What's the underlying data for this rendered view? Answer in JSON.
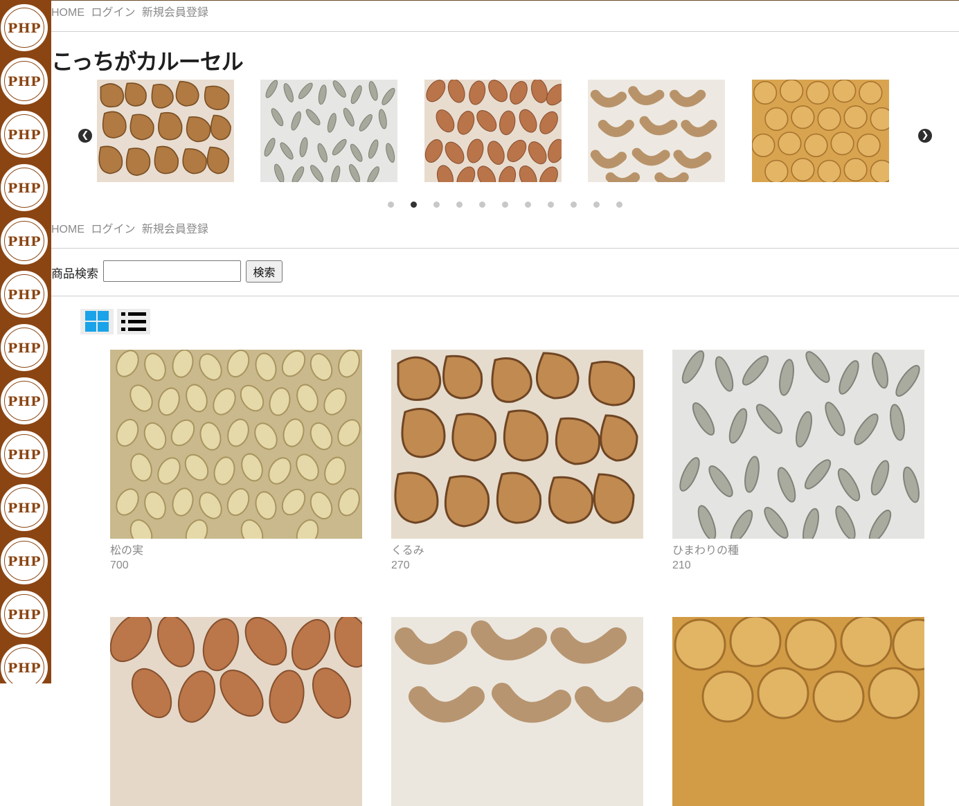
{
  "sidebar": {
    "badge_text": "PHP",
    "colors": {
      "background": "#8b4513",
      "badge": "#ffffff"
    }
  },
  "nav": {
    "items": [
      {
        "label": "HOME"
      },
      {
        "label": "ログイン"
      },
      {
        "label": "新規会員登録"
      }
    ]
  },
  "carousel": {
    "title": "こっちがカルーセル",
    "prev_icon": "chevron-left-circle-icon",
    "next_icon": "chevron-right-circle-icon",
    "slides": [
      {
        "image": "walnut"
      },
      {
        "image": "sunflower-seed"
      },
      {
        "image": "almond"
      },
      {
        "image": "cashew"
      },
      {
        "image": "giant-corn"
      }
    ],
    "dot_count": 11,
    "active_dot": 2
  },
  "search": {
    "label": "商品検索",
    "value": "",
    "placeholder": "",
    "button_label": "検索"
  },
  "view_toggle": {
    "grid_icon": "grid-view-icon",
    "list_icon": "list-view-icon",
    "active": "grid",
    "active_color": "#1aa3e8"
  },
  "products": [
    {
      "name": "松の実",
      "price": "700",
      "image": "pine-nut"
    },
    {
      "name": "くるみ",
      "price": "270",
      "image": "walnut"
    },
    {
      "name": "ひまわりの種",
      "price": "210",
      "image": "sunflower-seed"
    },
    {
      "name": "",
      "price": "",
      "image": "almond"
    },
    {
      "name": "",
      "price": "",
      "image": "cashew"
    },
    {
      "name": "",
      "price": "",
      "image": "giant-corn"
    }
  ]
}
